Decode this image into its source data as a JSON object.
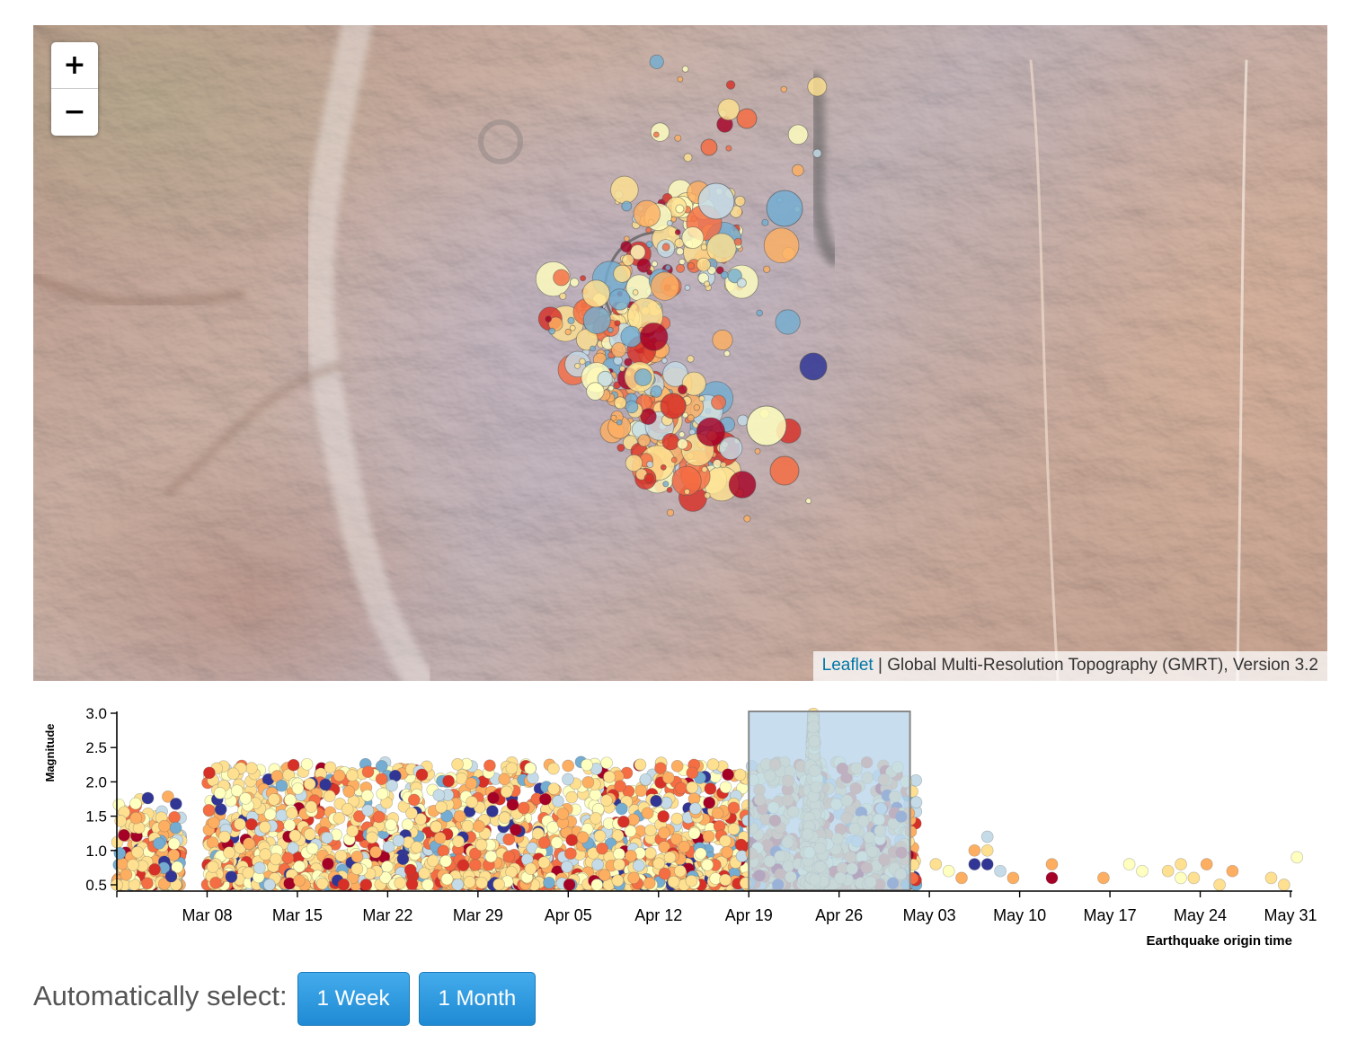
{
  "map": {
    "zoom_in_label": "+",
    "zoom_out_label": "−",
    "attribution_link": "Leaflet",
    "attribution_separator": " | ",
    "attribution_text": "Global Multi-Resolution Topography (GMRT), Version 3.2"
  },
  "controls": {
    "label": "Automatically select:",
    "week_label": "1 Week",
    "month_label": "1 Month"
  },
  "colors": {
    "button_blue": "#2e9ae0",
    "brush_fill": "#b9d5ea",
    "quake_scale": [
      "#313695",
      "#74add1",
      "#c5dce8",
      "#ffffbf",
      "#fee090",
      "#fdae61",
      "#f46d43",
      "#d73027",
      "#a50026"
    ]
  },
  "chart_data": {
    "type": "scatter",
    "xlabel": "Earthquake origin time",
    "ylabel": "Magnitude",
    "xlim": [
      "2015-03-01",
      "2015-05-31"
    ],
    "ylim": [
      0.5,
      3.0
    ],
    "yticks": [
      "0.5",
      "1.0",
      "1.5",
      "2.0",
      "2.5",
      "3.0"
    ],
    "xticks": [
      "Mar 08",
      "Mar 15",
      "Mar 22",
      "Mar 29",
      "Apr 05",
      "Apr 12",
      "Apr 19",
      "Apr 26",
      "May 03",
      "May 10",
      "May 17",
      "May 24",
      "May 31"
    ],
    "brush_selection": [
      "2015-04-19",
      "2015-05-01"
    ],
    "dense_activity": [
      {
        "period": "2015-03-01 to 2015-03-06",
        "max_magnitude": 1.8
      },
      {
        "period": "2015-03-08 to 2015-05-02",
        "max_magnitude": 2.3
      },
      {
        "period": "2015-04-23 to 2015-04-25",
        "max_magnitude": 3.0
      }
    ],
    "sparse_events": [
      {
        "x": "2015-05-03",
        "y": 0.8
      },
      {
        "x": "2015-05-04",
        "y": 0.7
      },
      {
        "x": "2015-05-05",
        "y": 0.6
      },
      {
        "x": "2015-05-06",
        "y": 1.0
      },
      {
        "x": "2015-05-06",
        "y": 0.8
      },
      {
        "x": "2015-05-07",
        "y": 1.2
      },
      {
        "x": "2015-05-07",
        "y": 1.0
      },
      {
        "x": "2015-05-07",
        "y": 0.8
      },
      {
        "x": "2015-05-08",
        "y": 0.7
      },
      {
        "x": "2015-05-09",
        "y": 0.6
      },
      {
        "x": "2015-05-12",
        "y": 0.8
      },
      {
        "x": "2015-05-12",
        "y": 0.6
      },
      {
        "x": "2015-05-16",
        "y": 0.6
      },
      {
        "x": "2015-05-18",
        "y": 0.8
      },
      {
        "x": "2015-05-19",
        "y": 0.7
      },
      {
        "x": "2015-05-21",
        "y": 0.7
      },
      {
        "x": "2015-05-22",
        "y": 0.8
      },
      {
        "x": "2015-05-22",
        "y": 0.6
      },
      {
        "x": "2015-05-23",
        "y": 0.6
      },
      {
        "x": "2015-05-24",
        "y": 0.8
      },
      {
        "x": "2015-05-25",
        "y": 0.5
      },
      {
        "x": "2015-05-26",
        "y": 0.7
      },
      {
        "x": "2015-05-29",
        "y": 0.6
      },
      {
        "x": "2015-05-30",
        "y": 0.5
      },
      {
        "x": "2015-05-31",
        "y": 0.9
      }
    ],
    "map_cluster": {
      "description_colors": "color encodes origin time on the diverging scale; circle size encodes magnitude"
    }
  }
}
